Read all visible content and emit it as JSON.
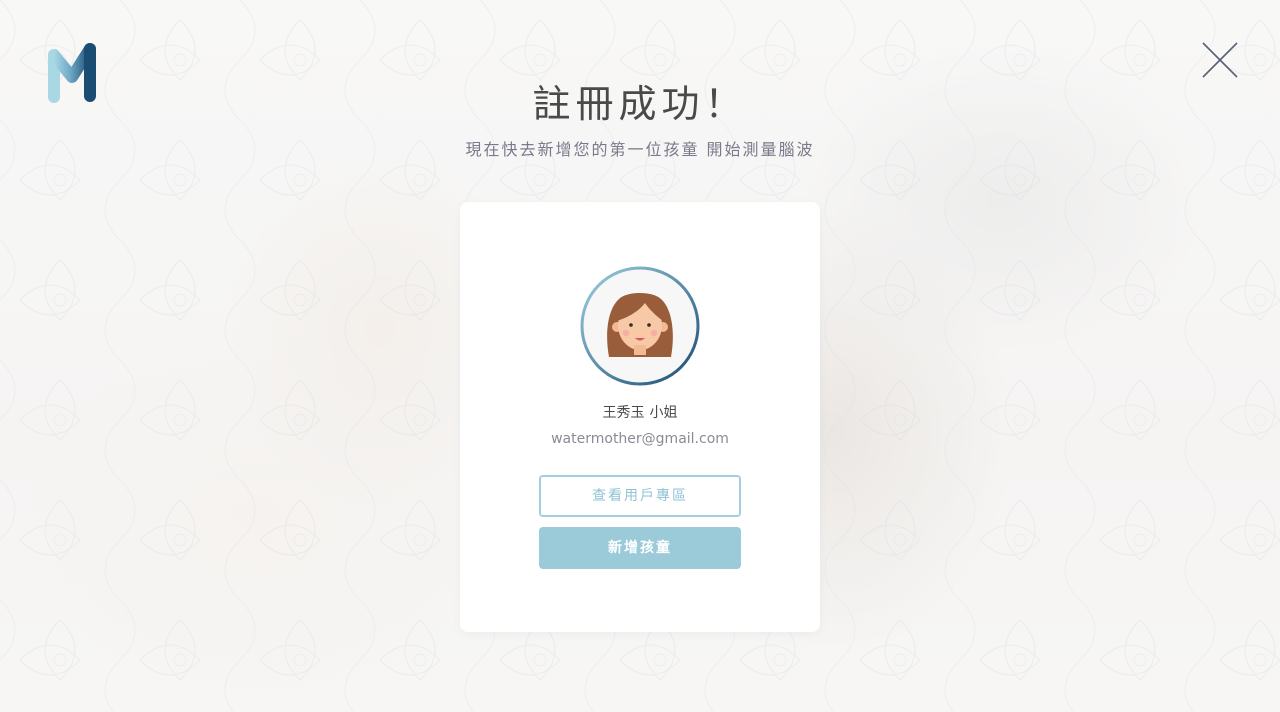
{
  "header": {
    "logo_icon": "brand-m-logo-icon",
    "close_icon": "close-icon"
  },
  "main": {
    "title": "註冊成功！",
    "subtitle": "現在快去新增您的第一位孩童 開始測量腦波"
  },
  "card": {
    "avatar_icon": "girl-avatar-icon",
    "user_name": "王秀玉",
    "user_title": "小姐",
    "user_email": "watermother@gmail.com",
    "view_account_label": "查看用戶專區",
    "add_child_label": "新增孩童"
  },
  "colors": {
    "accent": "#9bcbd9",
    "accent_border": "#a4cfdc",
    "logo_light": "#a9d7e4",
    "logo_dark": "#1b4c72",
    "heading": "#4a4a4a"
  }
}
